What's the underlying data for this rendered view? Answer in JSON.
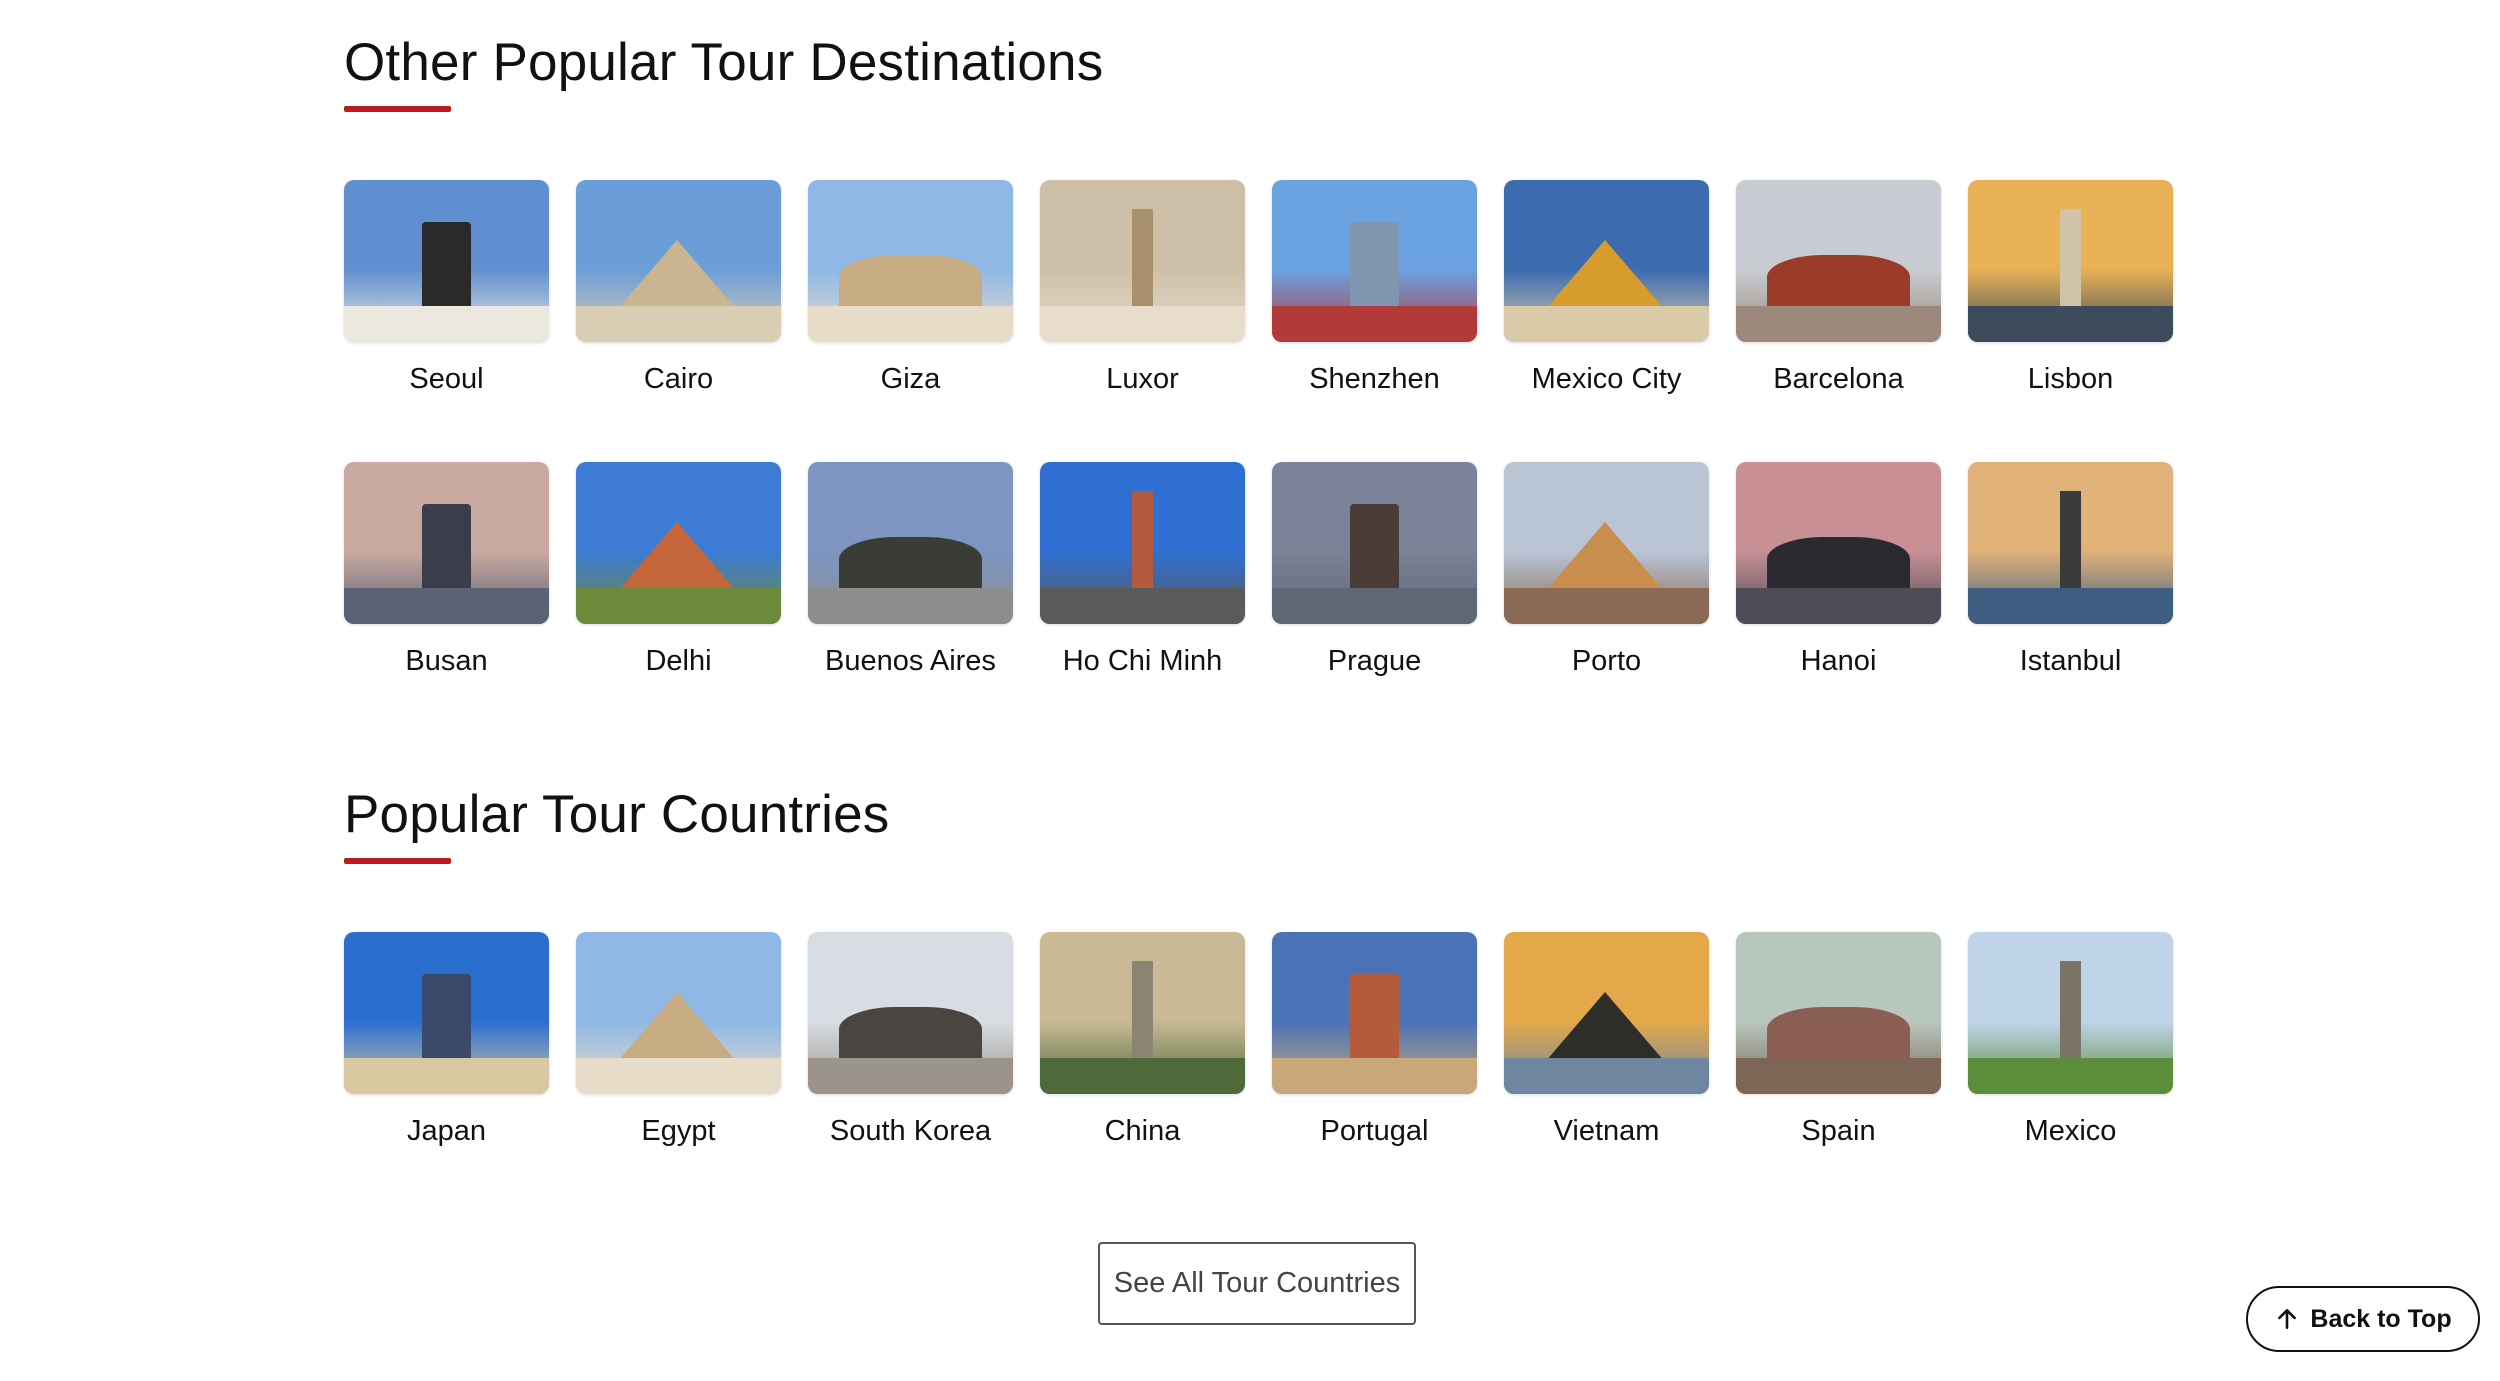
{
  "destinations_section": {
    "title": "Other Popular Tour Destinations",
    "items": [
      {
        "label": "Seoul",
        "icon": "seoul-gate-photo",
        "sky": "#5f8fd0",
        "ground": "#ece7df",
        "accent": "#2a2a2a"
      },
      {
        "label": "Cairo",
        "icon": "cairo-mosque-photo",
        "sky": "#6b9ed8",
        "ground": "#d9cdb4",
        "accent": "#c9b58f"
      },
      {
        "label": "Giza",
        "icon": "giza-pyramids-photo",
        "sky": "#8fb8e6",
        "ground": "#e6dcc8",
        "accent": "#c7ab82"
      },
      {
        "label": "Luxor",
        "icon": "luxor-temple-photo",
        "sky": "#cdbfa7",
        "ground": "#e8ddcb",
        "accent": "#a88f6e"
      },
      {
        "label": "Shenzhen",
        "icon": "shenzhen-skyline-photo",
        "sky": "#6aa2e2",
        "ground": "#b23a3a",
        "accent": "#7f95b0"
      },
      {
        "label": "Mexico City",
        "icon": "mexico-city-palace-photo",
        "sky": "#3c6bb0",
        "ground": "#d9cba8",
        "accent": "#d79d2c"
      },
      {
        "label": "Barcelona",
        "icon": "barcelona-plaza-photo",
        "sky": "#c8ccd2",
        "ground": "#9b8a7b",
        "accent": "#9b3b2a"
      },
      {
        "label": "Lisbon",
        "icon": "lisbon-tower-photo",
        "sky": "#e8b155",
        "ground": "#3c4c5c",
        "accent": "#d0c4a8"
      },
      {
        "label": "Busan",
        "icon": "busan-harbor-photo",
        "sky": "#c9a9a0",
        "ground": "#5b6275",
        "accent": "#3a3e4a"
      },
      {
        "label": "Delhi",
        "icon": "delhi-minar-photo",
        "sky": "#3d7bd4",
        "ground": "#6c8a3c",
        "accent": "#c5663a"
      },
      {
        "label": "Buenos Aires",
        "icon": "buenos-aires-statue-photo",
        "sky": "#7d95c0",
        "ground": "#8c8d8e",
        "accent": "#3a3d35"
      },
      {
        "label": "Ho Chi Minh",
        "icon": "ho-chi-minh-cathedral-photo",
        "sky": "#2f6fd1",
        "ground": "#5a5a5a",
        "accent": "#b35b3f"
      },
      {
        "label": "Prague",
        "icon": "prague-bridge-photo",
        "sky": "#7a8397",
        "ground": "#5f6676",
        "accent": "#4a3c36"
      },
      {
        "label": "Porto",
        "icon": "porto-houses-photo",
        "sky": "#b9c5d5",
        "ground": "#8a6a55",
        "accent": "#c78e4d"
      },
      {
        "label": "Hanoi",
        "icon": "hanoi-bay-photo",
        "sky": "#c88f95",
        "ground": "#4f4c55",
        "accent": "#2b2a30"
      },
      {
        "label": "Istanbul",
        "icon": "istanbul-skyline-photo",
        "sky": "#e0b27a",
        "ground": "#3f5f82",
        "accent": "#3b3b3b"
      }
    ]
  },
  "countries_section": {
    "title": "Popular Tour Countries",
    "items": [
      {
        "label": "Japan",
        "icon": "japan-fuji-photo",
        "sky": "#2a6fd0",
        "ground": "#d9c9a0",
        "accent": "#3b4a6a"
      },
      {
        "label": "Egypt",
        "icon": "egypt-pyramids-photo",
        "sky": "#8fb8e6",
        "ground": "#e6dcc8",
        "accent": "#c7ab82"
      },
      {
        "label": "South Korea",
        "icon": "south-korea-hanok-photo",
        "sky": "#d8dde3",
        "ground": "#9a948a",
        "accent": "#4a4540"
      },
      {
        "label": "China",
        "icon": "china-great-wall-photo",
        "sky": "#c9b995",
        "ground": "#4f6a3a",
        "accent": "#8a8570"
      },
      {
        "label": "Portugal",
        "icon": "portugal-town-photo",
        "sky": "#4b73b8",
        "ground": "#c8a878",
        "accent": "#b55a3a"
      },
      {
        "label": "Vietnam",
        "icon": "vietnam-salt-field-photo",
        "sky": "#e3a84a",
        "ground": "#6e86a0",
        "accent": "#2d2d2a"
      },
      {
        "label": "Spain",
        "icon": "spain-cathedral-photo",
        "sky": "#b8c7be",
        "ground": "#7d6656",
        "accent": "#8a5e52"
      },
      {
        "label": "Mexico",
        "icon": "mexico-pyramid-photo",
        "sky": "#bfd4e8",
        "ground": "#5c8d3a",
        "accent": "#7b7466"
      }
    ]
  },
  "see_all_button": {
    "label": "See All Tour Countries"
  },
  "back_to_top_button": {
    "label": "Back to Top",
    "icon": "arrow-up-icon"
  }
}
